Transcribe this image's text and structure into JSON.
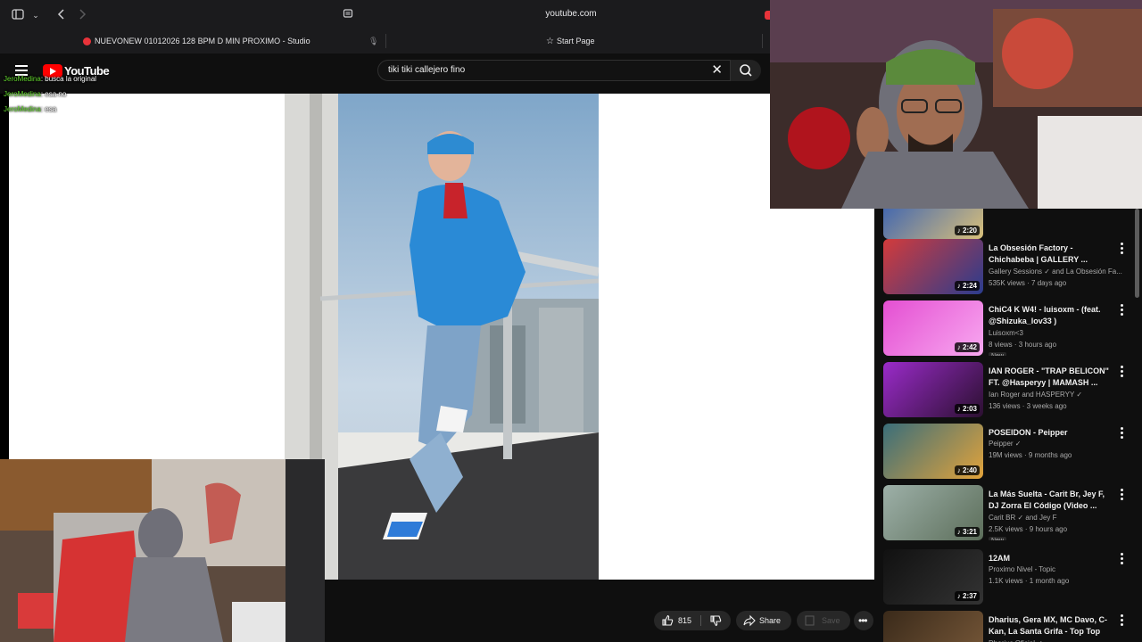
{
  "browser": {
    "address": "youtube.com",
    "tabs": [
      {
        "label": "NUEVONEW 01012026 128 BPM D MIN PROXIMO - Studio"
      },
      {
        "label": "Start Page"
      }
    ]
  },
  "youtube": {
    "logo_text": "YouTube",
    "search_value": "tiki tiki callejero fino"
  },
  "chat": [
    {
      "user": "JeroMedina",
      "message": "busca la original"
    },
    {
      "user": "JeroMedina",
      "message": "esa no"
    },
    {
      "user": "JeroMedina",
      "message": "esa"
    }
  ],
  "actions": {
    "like_count": "815",
    "share_label": "Share",
    "save_label": "Save"
  },
  "recommendations": [
    {
      "title": "",
      "channel": "",
      "meta": "",
      "duration": "2:20",
      "badge": "",
      "colors": [
        "#2a58b8",
        "#d9c07a"
      ]
    },
    {
      "title": "La Obsesión Factory - Chichabeba | GALLERY ...",
      "channel": "Gallery Sessions ✓ and La Obsesión Fa...",
      "meta": "535K views · 7 days ago",
      "duration": "2:24",
      "badge": "",
      "colors": [
        "#d33b3b",
        "#2a3c8e"
      ]
    },
    {
      "title": "ChiC4 K W4! - luisoxm - (feat. @Shizuka_lov33 )",
      "channel": "Luisoxm<3",
      "meta": "8 views · 3 hours ago",
      "duration": "2:42",
      "badge": "New",
      "colors": [
        "#e44fd2",
        "#f8a8f0"
      ]
    },
    {
      "title": "IAN ROGER - \"TRAP BELICON\" FT. @Hasperyy | MAMASH ...",
      "channel": "Ian Roger and HASPERYY ✓",
      "meta": "136 views · 3 weeks ago",
      "duration": "2:03",
      "badge": "",
      "colors": [
        "#9a2bc9",
        "#2b1030"
      ]
    },
    {
      "title": "POSEIDON - Peipper",
      "channel": "Peipper ✓",
      "meta": "19M views · 9 months ago",
      "duration": "2:40",
      "badge": "",
      "colors": [
        "#3a6e7a",
        "#e2a33b"
      ]
    },
    {
      "title": "La Más Suelta - Carit Br, Jey F, DJ Zorra El Código (Video ...",
      "channel": "Carit BR ✓ and Jey F",
      "meta": "2.5K views · 9 hours ago",
      "duration": "3:21",
      "badge": "New",
      "colors": [
        "#9db0a8",
        "#5c6e5a"
      ]
    },
    {
      "title": "12AM",
      "channel": "Proximo Nivel - Topic",
      "meta": "1.1K views · 1 month ago",
      "duration": "2:37",
      "badge": "",
      "colors": [
        "#111111",
        "#333333"
      ]
    },
    {
      "title": "Dharius, Gera MX, MC Davo, C-Kan, La Santa Grifa - Top Top",
      "channel": "Dharius Oficial ✓",
      "meta": "",
      "duration": "",
      "badge": "",
      "colors": [
        "#3a2a1a",
        "#7a5a3a"
      ]
    }
  ]
}
